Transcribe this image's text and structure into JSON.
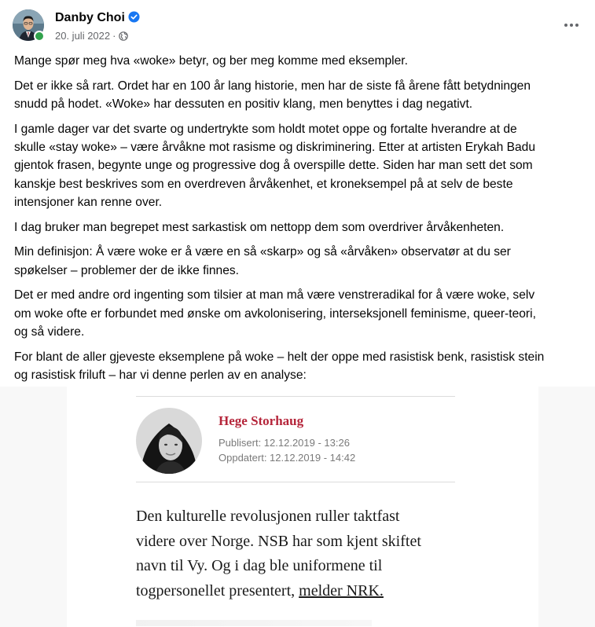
{
  "post": {
    "author": "Danby Choi",
    "date": "20. juli 2022",
    "meta_separator": "·",
    "paragraphs": [
      [
        "Mange spør meg hva «woke» betyr, og ber meg komme med eksempler."
      ],
      [
        "Det er ikke så rart. Ordet har en 100 år lang historie, men har de siste få årene fått betydningen",
        "snudd på hodet. «Woke» har dessuten en positiv klang, men benyttes i dag negativt."
      ],
      [
        "I gamle dager var det svarte og undertrykte som holdt motet oppe og fortalte hverandre at de",
        "skulle «stay woke» – være årvåkne mot rasisme og diskriminering. Etter at artisten Erykah Badu",
        "gjentok frasen, begynte unge og progressive dog å overspille dette. Siden har man sett det som",
        "kanskje best beskrives som en overdreven årvåkenhet, et kroneksempel på at selv de beste",
        "intensjoner kan renne over."
      ],
      [
        "I dag bruker man begrepet mest sarkastisk om nettopp dem som overdriver årvåkenheten."
      ],
      [
        "Min definisjon: Å være woke er å være en så «skarp» og så «årvåken» observatør at du ser",
        "spøkelser – problemer der de ikke finnes."
      ],
      [
        "Det er med andre ord ingenting som tilsier at man må være venstreradikal for å være woke, selv",
        "om woke ofte er forbundet med ønske om avkolonisering, interseksjonell feminisme, queer-teori,",
        "og så videre."
      ],
      [
        "For blant de aller gjeveste eksemplene på woke – helt der oppe med rasistisk benk, rasistisk stein",
        "og rasistisk friluft – har vi denne perlen av en analyse:"
      ]
    ]
  },
  "article": {
    "author": "Hege Storhaug",
    "published": "Publisert: 12.12.2019 - 13:26",
    "updated": "Oppdatert: 12.12.2019 - 14:42",
    "body_lines": [
      "Den kulturelle revolusjonen ruller taktfast",
      "videre over Norge. NSB har som kjent skiftet",
      "navn til Vy. Og i dag ble uniformene til"
    ],
    "last_line_prefix": "togpersonellet presentert, ",
    "link_text": "melder NRK."
  },
  "icons": {
    "verified": "verified-badge-icon",
    "audience": "globe-icon",
    "more": "more-options-icon"
  },
  "colors": {
    "verified_blue": "#1877f2",
    "article_author_red": "#b5253a",
    "online_green": "#31a24c",
    "meta_gray": "#65676b"
  }
}
